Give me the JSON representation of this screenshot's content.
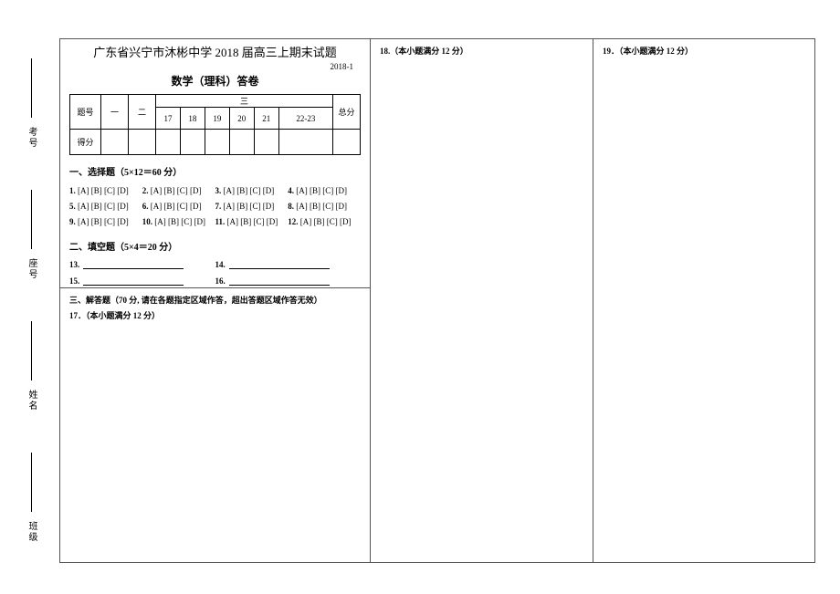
{
  "header": {
    "title_main": "广东省兴宁市沐彬中学 2018 届高三上期末试题",
    "date": "2018-1",
    "title_sub": "数学（理科）答卷"
  },
  "score_table": {
    "row_label_q": "题号",
    "row_label_s": "得分",
    "col_one": "一",
    "col_two": "二",
    "col_three": "三",
    "sub_17": "17",
    "sub_18": "18",
    "sub_19": "19",
    "sub_20": "20",
    "sub_21": "21",
    "sub_22_23": "22-23",
    "col_total": "总分"
  },
  "section1": {
    "heading": "一、选择题（5×12＝60 分）",
    "items": [
      {
        "n": "1.",
        "opts": "[A] [B] [C] [D]"
      },
      {
        "n": "2.",
        "opts": "[A] [B] [C] [D]"
      },
      {
        "n": "3.",
        "opts": "[A] [B] [C] [D]"
      },
      {
        "n": "4.",
        "opts": "[A] [B] [C] [D]"
      },
      {
        "n": "5.",
        "opts": "[A] [B] [C] [D]"
      },
      {
        "n": "6.",
        "opts": "[A] [B] [C] [D]"
      },
      {
        "n": "7.",
        "opts": "[A] [B] [C] [D]"
      },
      {
        "n": "8.",
        "opts": "[A] [B] [C] [D]"
      },
      {
        "n": "9.",
        "opts": "[A] [B] [C] [D]"
      },
      {
        "n": "10.",
        "opts": "[A] [B] [C] [D]"
      },
      {
        "n": "11.",
        "opts": "[A] [B] [C] [D]"
      },
      {
        "n": "12.",
        "opts": "[A] [B] [C] [D]"
      }
    ]
  },
  "section2": {
    "heading": "二、填空题（5×4＝20 分）",
    "items": [
      {
        "n": "13."
      },
      {
        "n": "14."
      },
      {
        "n": "15."
      },
      {
        "n": "16."
      }
    ]
  },
  "section3": {
    "heading": "三、解答题（70 分, 请在各题指定区域作答，超出答题区域作答无效）",
    "q17": "17．（本小题满分 12 分）"
  },
  "q18": "18.（本小题满分 12 分）",
  "q19": "19．（本小题满分 12 分）",
  "sidebar": {
    "exam_no": "考号",
    "seat_no": "座号",
    "name": "姓名",
    "class": "班级"
  }
}
